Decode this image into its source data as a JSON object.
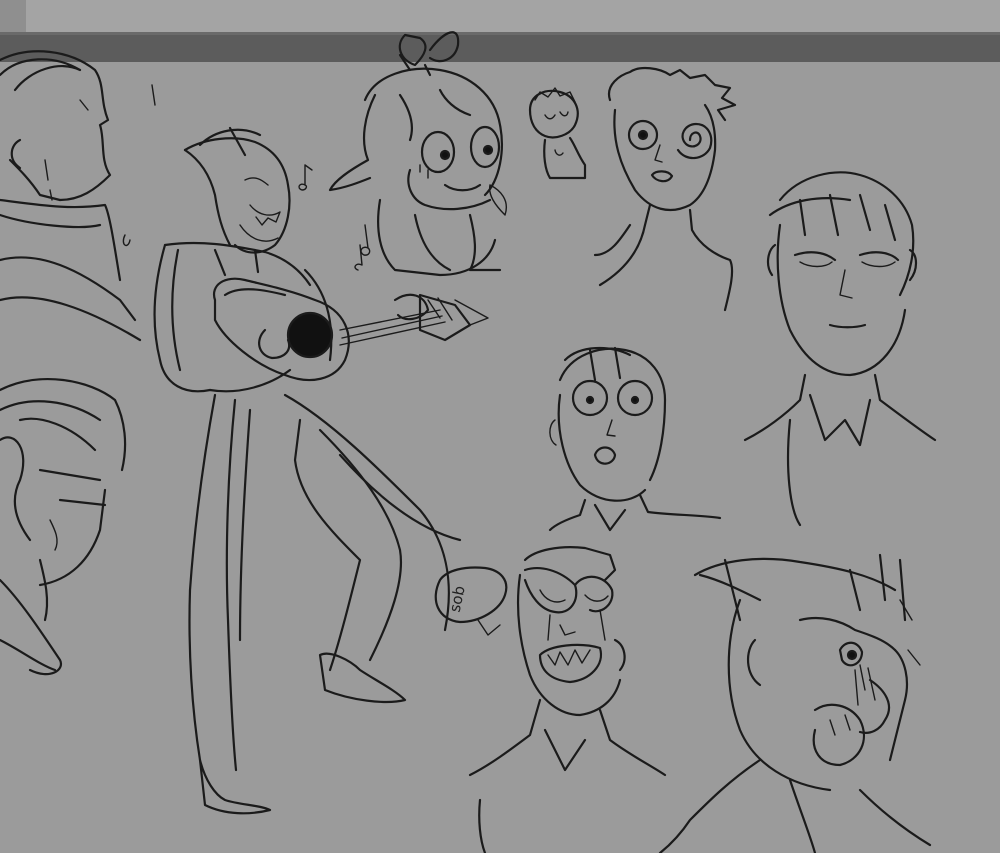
{
  "canvas": {
    "background_color": "#9b9b9b",
    "stroke_color": "#1b1b1b",
    "toolbar_color": "#5c5c5c"
  },
  "sketches": {
    "speech_bubble_text": "sob"
  }
}
